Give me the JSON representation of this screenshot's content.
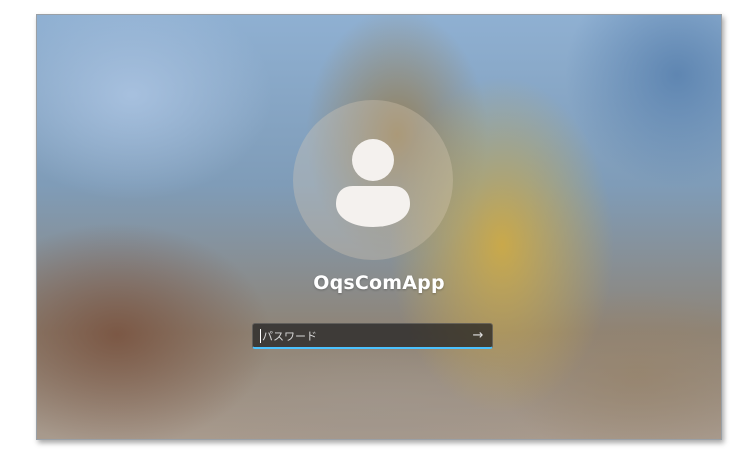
{
  "login": {
    "username": "OqsComApp",
    "password_placeholder": "パスワード",
    "submit_icon": "arrow-right-icon",
    "submit_glyph": "→",
    "avatar_icon": "user-icon"
  },
  "colors": {
    "focus_underline": "#4cc2ff",
    "text": "#ffffff"
  }
}
